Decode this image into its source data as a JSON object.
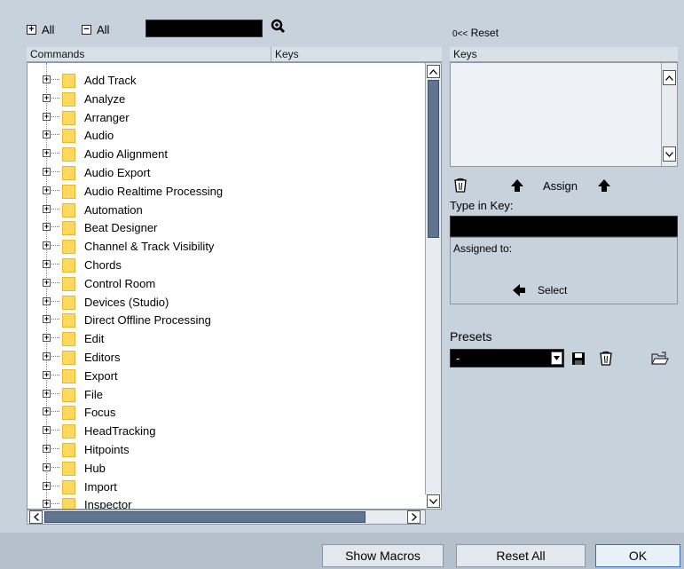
{
  "toolbar": {
    "expand_all_label": "All",
    "collapse_all_label": "All",
    "search_value": "",
    "reset_label": "Reset",
    "reset_prefix": "0<<"
  },
  "columns": {
    "commands": "Commands",
    "keys": "Keys"
  },
  "commands": [
    "Add Track",
    "Analyze",
    "Arranger",
    "Audio",
    "Audio Alignment",
    "Audio Export",
    "Audio Realtime Processing",
    "Automation",
    "Beat Designer",
    "Channel & Track Visibility",
    "Chords",
    "Control Room",
    "Devices (Studio)",
    "Direct Offline Processing",
    "Edit",
    "Editors",
    "Export",
    "File",
    "Focus",
    "HeadTracking",
    "Hitpoints",
    "Hub",
    "Import",
    "Inspector"
  ],
  "right_panel": {
    "keys_header": "Keys",
    "assign_label": "Assign",
    "type_in_key_label": "Type in Key:",
    "type_in_key_value": "",
    "assigned_to_label": "Assigned to:",
    "select_label": "Select",
    "presets_label": "Presets",
    "preset_value": "-"
  },
  "footer": {
    "show_macros": "Show Macros",
    "reset_all": "Reset All",
    "ok": "OK"
  }
}
